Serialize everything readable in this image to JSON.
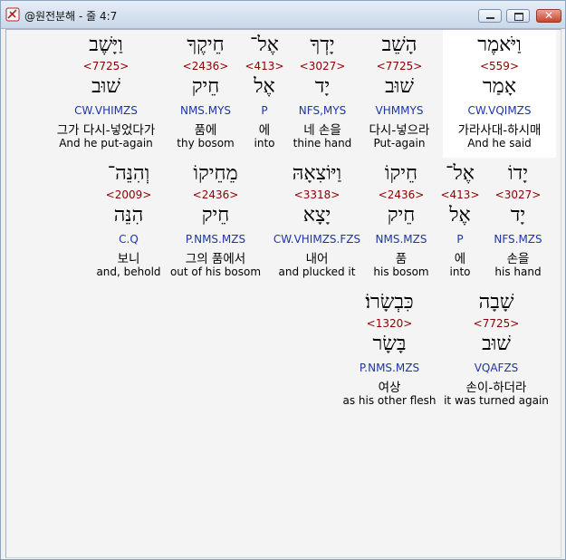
{
  "window": {
    "title": "@원전분해 - 줄 4:7",
    "close_glyph": "✕"
  },
  "words": [
    {
      "hebrew": "וַיֹּאמֶר",
      "strong": "<559>",
      "lemma": "אָמַר",
      "parse": "CW.VQIMZS",
      "korean": "가라사대-하시매",
      "english": "And he said",
      "selected": true
    },
    {
      "hebrew": "הָשֵׁב",
      "strong": "<7725>",
      "lemma": "שׁוּב",
      "parse": "VHMMYS",
      "korean": "다시-넣으라",
      "english": "Put-again"
    },
    {
      "hebrew": "יָדְךָ",
      "strong": "<3027>",
      "lemma": "יָד",
      "parse": "NFS,MYS",
      "korean": "네 손을",
      "english": "thine hand"
    },
    {
      "hebrew": "אֶל־",
      "strong": "<413>",
      "lemma": "אֶל",
      "parse": "P",
      "korean": "에",
      "english": "into"
    },
    {
      "hebrew": "חֵיקֶךָ",
      "strong": "<2436>",
      "lemma": "חֵיק",
      "parse": "NMS.MYS",
      "korean": "품에",
      "english": "thy bosom"
    },
    {
      "hebrew": "וַיָּשֶׁב",
      "strong": "<7725>",
      "lemma": "שׁוּב",
      "parse": "CW.VHIMZS",
      "korean": "그가 다시-넣었다가",
      "english": "And he put-again"
    },
    {
      "hebrew": "יָדוֹ",
      "strong": "<3027>",
      "lemma": "יָד",
      "parse": "NFS.MZS",
      "korean": "손을",
      "english": "his hand"
    },
    {
      "hebrew": "אֶל־",
      "strong": "<413>",
      "lemma": "אֶל",
      "parse": "P",
      "korean": "에",
      "english": "into"
    },
    {
      "hebrew": "חֵיקוֹ",
      "strong": "<2436>",
      "lemma": "חֵיק",
      "parse": "NMS.MZS",
      "korean": "품",
      "english": "his bosom"
    },
    {
      "hebrew": "וַיּוֹצִאָהּ",
      "strong": "<3318>",
      "lemma": "יָצָא",
      "parse": "CW.VHIMZS.FZS",
      "korean": "내어",
      "english": "and plucked it"
    },
    {
      "hebrew": "מֵחֵיקוֹ",
      "strong": "<2436>",
      "lemma": "חֵיק",
      "parse": "P.NMS.MZS",
      "korean": "그의 품에서",
      "english": "out of his bosom"
    },
    {
      "hebrew": "וְהִנֵּה־",
      "strong": "<2009>",
      "lemma": "הִנֵּה",
      "parse": "C.Q",
      "korean": "보니",
      "english": "and, behold"
    },
    {
      "hebrew": "שָׁבָה",
      "strong": "<7725>",
      "lemma": "שׁוּב",
      "parse": "VQAFZS",
      "korean": "손이-하더라",
      "english": "it was turned again"
    },
    {
      "hebrew": "כִּבְשָׂרוֹ׃",
      "strong": "<1320>",
      "lemma": "בָּשָׂר",
      "parse": "P.NMS.MZS",
      "korean": "여상",
      "english": "as his other flesh"
    }
  ]
}
